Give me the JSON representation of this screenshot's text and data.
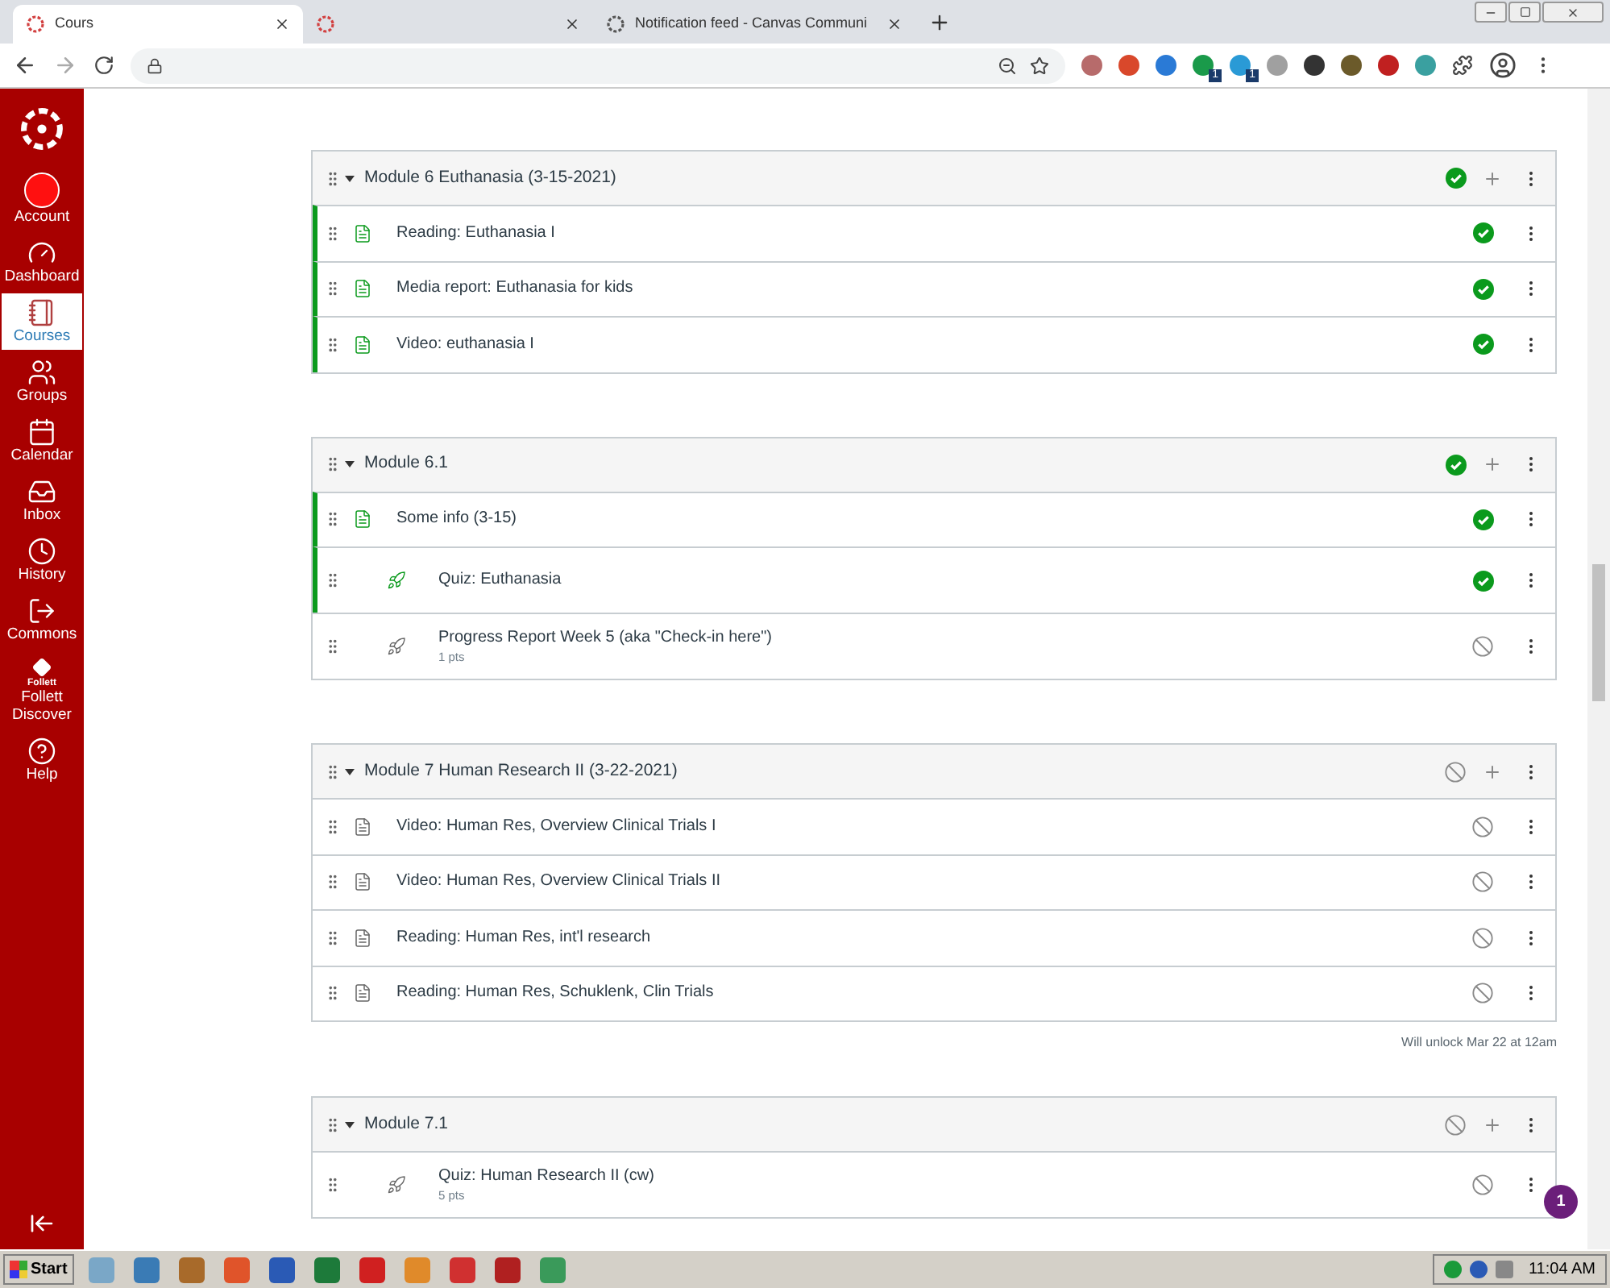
{
  "browser": {
    "tabs": [
      {
        "title": "Cours",
        "selected": true
      },
      {
        "selected": false
      },
      {
        "title": "Notification feed - Canvas Communi",
        "selected": false
      }
    ],
    "extensions": [
      {
        "color": "#b76b6b"
      },
      {
        "color": "#d9482b"
      },
      {
        "color": "#2a7ad6"
      },
      {
        "color": "#1a9a4a",
        "badge": "1"
      },
      {
        "color": "#2a9ad6",
        "badge": "1"
      },
      {
        "color": "#a0a0a0"
      },
      {
        "color": "#333333"
      },
      {
        "color": "#6b5a2a"
      },
      {
        "color": "#c02020"
      },
      {
        "color": "#3aa0a0"
      }
    ]
  },
  "sidebar": {
    "items": [
      {
        "kind": "account",
        "label": "Account",
        "selected": false
      },
      {
        "kind": "dashboard",
        "label": "Dashboard",
        "selected": false
      },
      {
        "kind": "courses",
        "label": "Courses",
        "selected": true
      },
      {
        "kind": "groups",
        "label": "Groups",
        "selected": false
      },
      {
        "kind": "calendar",
        "label": "Calendar",
        "selected": false
      },
      {
        "kind": "inbox",
        "label": "Inbox",
        "selected": false
      },
      {
        "kind": "history",
        "label": "History",
        "selected": false
      },
      {
        "kind": "commons",
        "label": "Commons",
        "selected": false
      },
      {
        "kind": "follett",
        "logo_text": "Follett",
        "label": "Follett Discover",
        "selected": false
      },
      {
        "kind": "help",
        "label": "Help",
        "selected": false
      }
    ]
  },
  "modules": [
    {
      "title": "Module 6 Euthanasia (3-15-2021)",
      "completed": true,
      "items": [
        {
          "kind": "page",
          "title": "Reading: Euthanasia I",
          "completed": true
        },
        {
          "kind": "page",
          "title": "Media report: Euthanasia for kids",
          "completed": true
        },
        {
          "kind": "page",
          "title": "Video: euthanasia I",
          "completed": true
        }
      ]
    },
    {
      "title": "Module 6.1",
      "completed": true,
      "items": [
        {
          "kind": "page",
          "title": "Some info (3-15)",
          "completed": true
        },
        {
          "kind": "quiz",
          "title": "Quiz: Euthanasia",
          "completed": true
        },
        {
          "kind": "quiz",
          "title": "Progress Report Week 5 (aka \"Check-in here\")",
          "points": "1 pts",
          "completed": false
        }
      ]
    },
    {
      "title": "Module 7 Human Research II (3-22-2021)",
      "completed": false,
      "unlock_note": "Will unlock Mar 22 at 12am",
      "items": [
        {
          "kind": "page",
          "title": "Video: Human Res, Overview Clinical Trials I",
          "completed": false
        },
        {
          "kind": "page",
          "title": "Video: Human Res, Overview Clinical Trials II",
          "completed": false
        },
        {
          "kind": "page",
          "title": "Reading: Human Res, int'l research",
          "completed": false
        },
        {
          "kind": "page",
          "title": "Reading: Human Res, Schuklenk, Clin Trials",
          "completed": false
        }
      ]
    },
    {
      "title": "Module 7.1",
      "completed": false,
      "items": [
        {
          "kind": "quiz",
          "title": "Quiz: Human Research II (cw)",
          "points": "5 pts",
          "completed": false
        }
      ]
    }
  ],
  "notification_badge": "1",
  "taskbar": {
    "start": "Start",
    "time": "11:04 AM"
  }
}
